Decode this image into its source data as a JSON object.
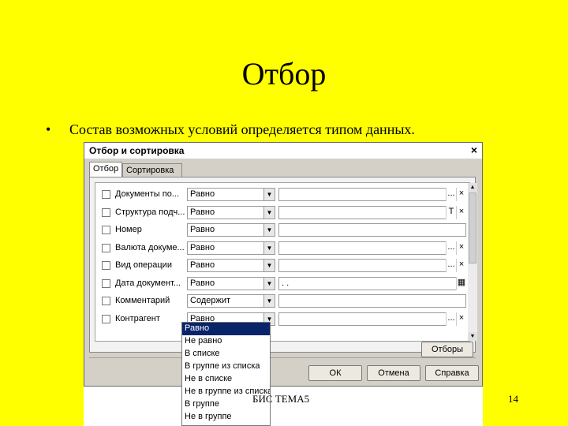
{
  "slide": {
    "title": "Отбор",
    "bullet_symbol": "•",
    "bullet_text": "Состав возможных условий определяется типом данных.",
    "footer": "БИС ТЕМА5",
    "page_number": "14"
  },
  "dialog": {
    "title": "Отбор и сортировка",
    "close_glyph": "×",
    "tabs": [
      {
        "label": "Отбор",
        "active": true
      },
      {
        "label": "Сортировка",
        "active": false
      }
    ],
    "rows": [
      {
        "field": "Документы по...",
        "condition": "Равно",
        "value": "",
        "btn1": "...",
        "btn2": "×"
      },
      {
        "field": "Структура подч...",
        "condition": "Равно",
        "value": "",
        "btn1": "T",
        "btn2": "×"
      },
      {
        "field": "Номер",
        "condition": "Равно",
        "value": "",
        "btn1": "",
        "btn2": ""
      },
      {
        "field": "Валюта докуме...",
        "condition": "Равно",
        "value": "",
        "btn1": "...",
        "btn2": "×"
      },
      {
        "field": "Вид операции",
        "condition": "Равно",
        "value": "",
        "btn1": "...",
        "btn2": "×"
      },
      {
        "field": "Дата документ...",
        "condition": "Равно",
        "value": ". .",
        "btn1": "",
        "btn2": "▦"
      },
      {
        "field": "Комментарий",
        "condition": "Содержит",
        "value": "",
        "btn1": "",
        "btn2": ""
      },
      {
        "field": "Контрагент",
        "condition": "Равно",
        "value": "",
        "btn1": "...",
        "btn2": "×"
      }
    ],
    "cond_arrow": "▼",
    "filters_button": "Отборы",
    "ok_button": "ОК",
    "cancel_button": "Отмена",
    "help_button": "Справка"
  },
  "condition_dropdown": {
    "options": [
      "Равно",
      "Не равно",
      "В списке",
      "В группе из списка",
      "Не в списке",
      "Не в группе из списка",
      "В группе",
      "Не в группе"
    ],
    "selected": "Равно"
  }
}
